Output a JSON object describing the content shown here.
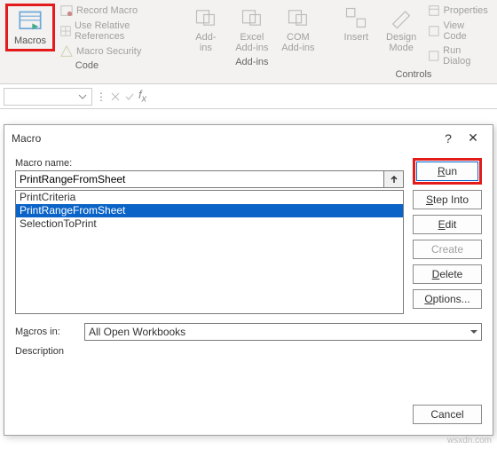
{
  "ribbon": {
    "code_group": {
      "label": "Code",
      "macros": "Macros",
      "record": "Record Macro",
      "relative": "Use Relative References",
      "security": "Macro Security"
    },
    "addins_group": {
      "label": "Add-ins",
      "addins": "Add-\nins",
      "excel": "Excel\nAdd-ins",
      "com": "COM\nAdd-ins"
    },
    "controls_group": {
      "label": "Controls",
      "insert": "Insert",
      "design": "Design\nMode",
      "properties": "Properties",
      "viewcode": "View Code",
      "rundialog": "Run Dialog"
    }
  },
  "dialog": {
    "title": "Macro",
    "help": "?",
    "close": "✕",
    "name_label": "Macro name:",
    "name_value": "PrintRangeFromSheet",
    "list": {
      "item0": "PrintCriteria",
      "item1": "PrintRangeFromSheet",
      "item2": "SelectionToPrint"
    },
    "buttons": {
      "run": "Run",
      "stepinto": "Step Into",
      "edit": "Edit",
      "create": "Create",
      "delete": "Delete",
      "options": "Options...",
      "cancel": "Cancel"
    },
    "macros_in_label": "Macros in:",
    "macros_in_value": "All Open Workbooks",
    "description_label": "Description"
  },
  "watermark": "wsxdn.com"
}
